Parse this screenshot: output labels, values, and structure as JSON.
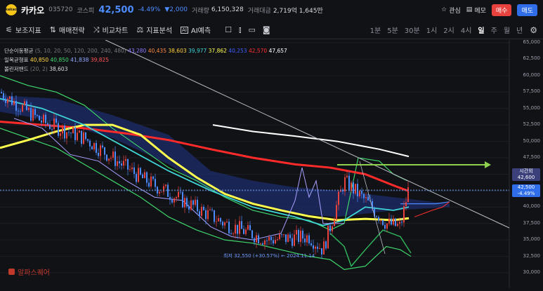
{
  "header": {
    "logo_text": "kakao",
    "name": "카카오",
    "code": "035720",
    "market": "코스피",
    "price": "42,500",
    "change_pct": "-4.49%",
    "change_abs": "▼2,000",
    "volume_label": "거래량",
    "volume_value": "6,150,328",
    "turnover_label": "거래대금",
    "turnover_value": "2,719억 1,645만",
    "watch_label": "관심",
    "memo_label": "메모",
    "buy_label": "매수",
    "sell_label": "매도"
  },
  "toolbar": {
    "aux_indicator": "보조지표",
    "trade_strategy": "매매전략",
    "compare_chart": "비교차트",
    "indicator_analysis": "지표분석",
    "ai_forecast": "AI예측",
    "periods": [
      "1분",
      "5분",
      "30분",
      "1시",
      "2시",
      "4시",
      "일",
      "주",
      "월",
      "년"
    ],
    "active_period": "일"
  },
  "legend": {
    "ma_label": "단순이동평균",
    "ma_params": "(5, 10, 20, 50, 120, 200, 240, 480)",
    "ma_values": [
      {
        "v": "43,280",
        "color": "#8a7bff"
      },
      {
        "v": "40,435",
        "color": "#ff8a3d"
      },
      {
        "v": "38,603",
        "color": "#ffd23f"
      },
      {
        "v": "39,977",
        "color": "#3fd6d6"
      },
      {
        "v": "37,862",
        "color": "#ffff4d"
      },
      {
        "v": "40,253",
        "color": "#3f5fff"
      },
      {
        "v": "42,570",
        "color": "#ff3030"
      },
      {
        "v": "47,657",
        "color": "#ffffff"
      }
    ],
    "ichimoku_label": "일목균형표",
    "ichimoku_values": [
      {
        "v": "40,850",
        "color": "#ffd23f"
      },
      {
        "v": "40,850",
        "color": "#3fd66b"
      },
      {
        "v": "41,838",
        "color": "#8fa4ff"
      },
      {
        "v": "39,825",
        "color": "#ff5050"
      }
    ],
    "bollinger_label": "볼린저밴드",
    "bollinger_params": "(20, 2)",
    "bollinger_values": [
      {
        "v": "38,603",
        "color": "#d7d9de"
      }
    ]
  },
  "y_axis": [
    "65,000",
    "62,500",
    "60,000",
    "57,500",
    "55,000",
    "52,500",
    "50,000",
    "47,500",
    "45,000",
    "42,500",
    "40,000",
    "37,500",
    "35,000",
    "32,500",
    "30,000"
  ],
  "price_tags": {
    "time_left_label": "시간외",
    "time_left_value": "42,600",
    "current_value": "42,500",
    "current_pct": "-4.49%"
  },
  "annotation": "최저 32,550 (+30.57%) ← 2024.11.14",
  "brand": "알파스퀘어",
  "colors": {
    "up": "#e8423f",
    "down": "#4d8cff",
    "target_line": "#8fd14f"
  }
}
